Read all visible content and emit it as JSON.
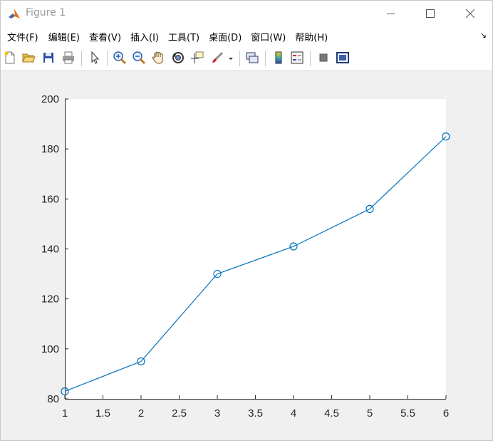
{
  "window": {
    "title": "Figure 1"
  },
  "menu": [
    {
      "label": "文件(F)"
    },
    {
      "label": "编辑(E)"
    },
    {
      "label": "查看(V)"
    },
    {
      "label": "插入(I)"
    },
    {
      "label": "工具(T)"
    },
    {
      "label": "桌面(D)"
    },
    {
      "label": "窗口(W)"
    },
    {
      "label": "帮助(H)"
    }
  ],
  "colors": {
    "line": "#0072bd",
    "axes_bg": "#ffffff",
    "figure_bg": "#f0f0f0"
  },
  "chart_data": {
    "type": "line",
    "x": [
      1,
      2,
      3,
      4,
      5,
      6
    ],
    "series": [
      {
        "values": [
          83,
          95,
          130,
          141,
          156,
          185
        ],
        "marker": "circle"
      }
    ],
    "xlim": [
      1,
      6
    ],
    "ylim": [
      80,
      200
    ],
    "xticks": [
      "1",
      "1.5",
      "2",
      "2.5",
      "3",
      "3.5",
      "4",
      "4.5",
      "5",
      "5.5",
      "6"
    ],
    "yticks": [
      "80",
      "100",
      "120",
      "140",
      "160",
      "180",
      "200"
    ],
    "grid": false,
    "title": "",
    "xlabel": "",
    "ylabel": ""
  }
}
